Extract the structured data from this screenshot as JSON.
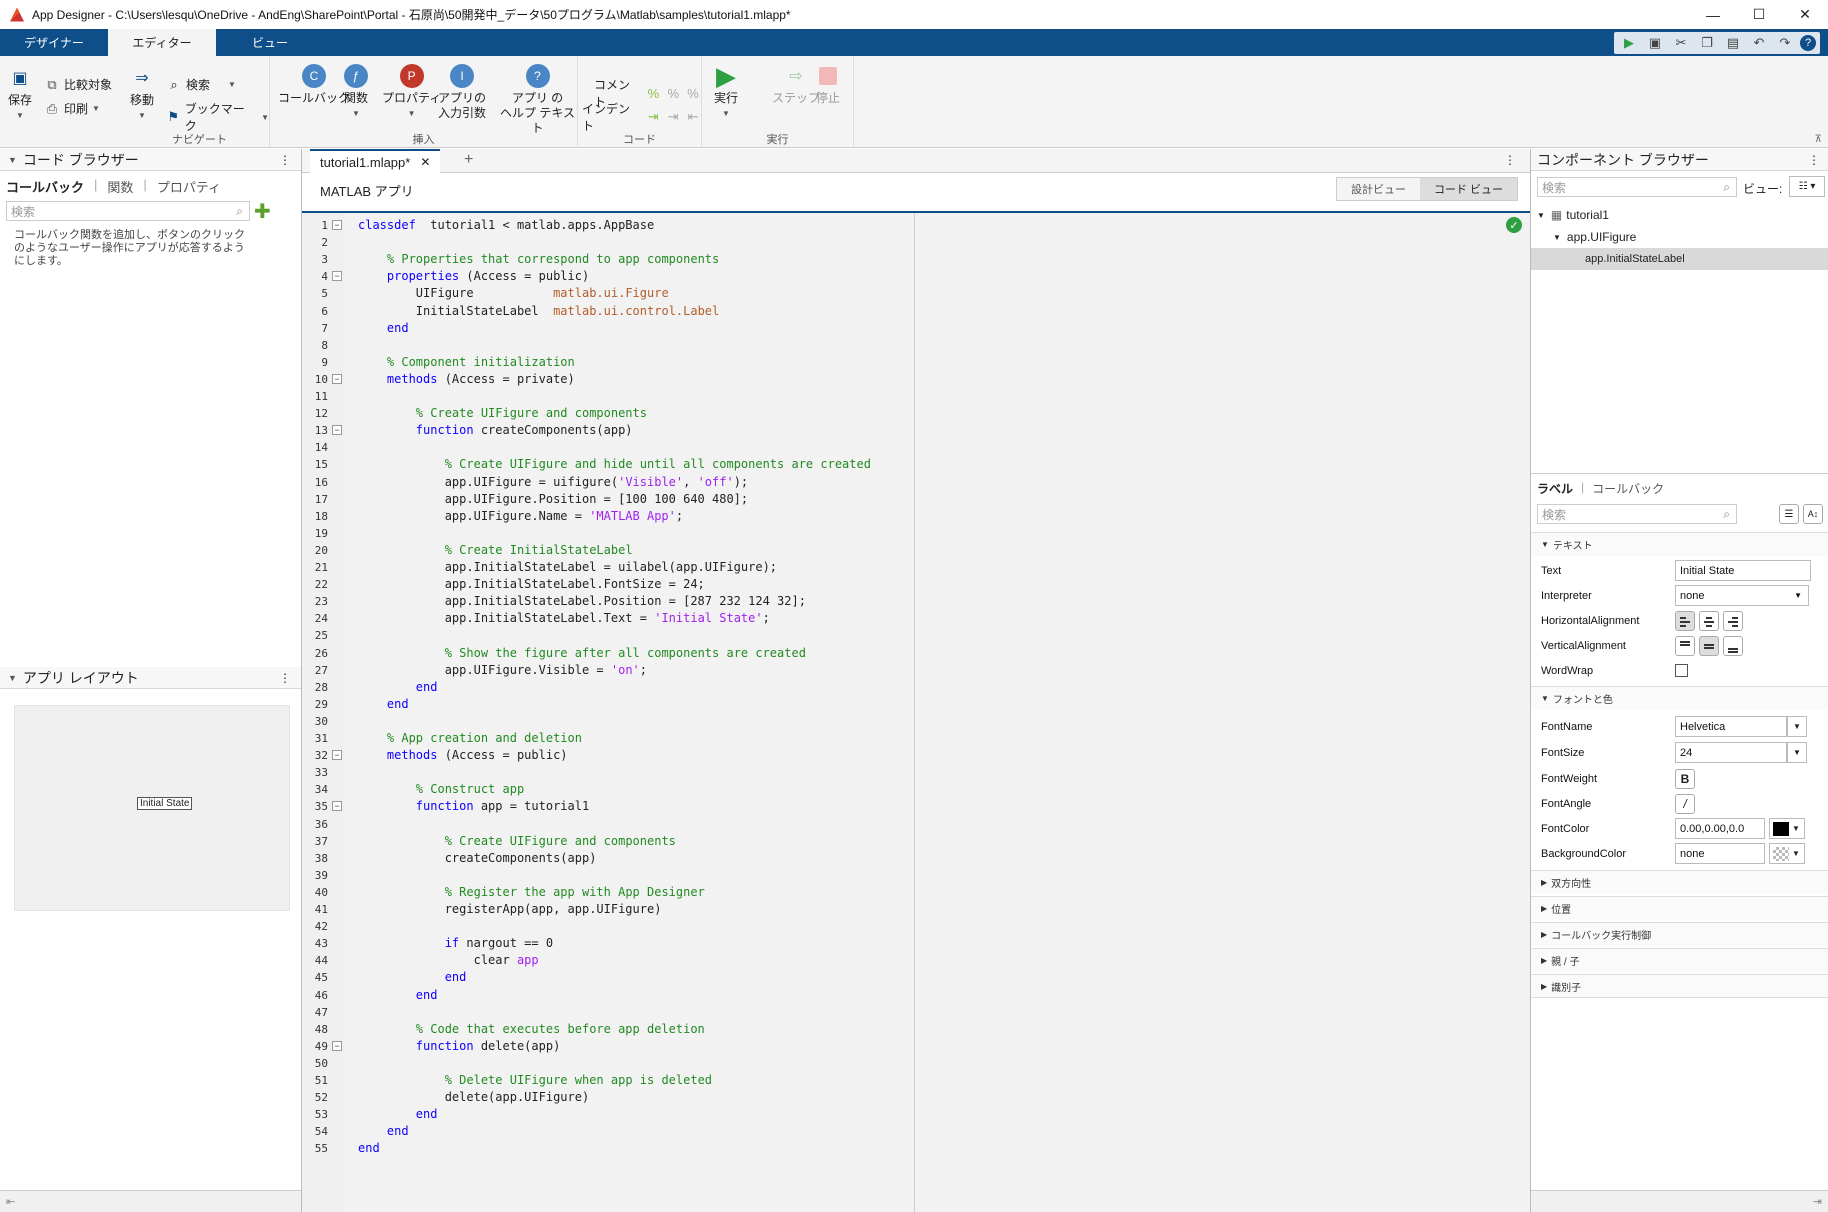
{
  "window": {
    "title": "App Designer - C:\\Users\\lesqu\\OneDrive - AndEng\\SharePoint\\Portal - 石原尚\\50開発中_データ\\50プログラム\\Matlab\\samples\\tutorial1.mlapp*",
    "minimize": "—",
    "maximize": "☐",
    "close": "✕"
  },
  "tabs": [
    {
      "label": "デザイナー"
    },
    {
      "label": "エディター"
    },
    {
      "label": "ビュー"
    }
  ],
  "ribbon": {
    "save": "保存",
    "compare": "比較対象",
    "print": "印刷",
    "move": "移動",
    "search": "検索",
    "bookmark": "ブックマーク",
    "navigate_group": "ナビゲート",
    "callback": "コールバック",
    "function": "関数",
    "property": "プロパティ",
    "app_input_1": "アプリの",
    "app_input_2": "入力引数",
    "app_help_1": "アプリ の",
    "app_help_2": "ヘルプ テキスト",
    "insert_group": "挿入",
    "comment": "コメント",
    "indent": "インデント",
    "code_group": "コード",
    "run": "実行",
    "step": "ステップ",
    "stop": "停止",
    "run_group": "実行"
  },
  "code_browser": {
    "title": "コード ブラウザー",
    "tab_callbacks": "コールバック",
    "tab_functions": "関数",
    "tab_properties": "プロパティ",
    "search_placeholder": "検索",
    "hint": "コールバック関数を追加し、ボタンのクリックのようなユーザー操作にアプリが応答するようにします。"
  },
  "app_layout": {
    "title": "アプリ レイアウト",
    "label": "Initial State"
  },
  "editor": {
    "doc_tab": "tutorial1.mlapp*",
    "header": "MATLAB アプリ",
    "design_view": "設計ビュー",
    "code_view": "コード ビュー"
  },
  "code_lines": [
    {
      "n": "1",
      "fold": true,
      "t": [
        [
          "kw",
          "classdef"
        ],
        [
          "",
          "  tutorial1 < matlab.apps.AppBase"
        ]
      ]
    },
    {
      "n": "2",
      "t": []
    },
    {
      "n": "3",
      "t": [
        [
          "",
          "    "
        ],
        [
          "cm",
          "% Properties that correspond to app components"
        ]
      ]
    },
    {
      "n": "4",
      "fold": true,
      "t": [
        [
          "",
          "    "
        ],
        [
          "kw",
          "properties"
        ],
        [
          "",
          " (Access = public)"
        ]
      ]
    },
    {
      "n": "5",
      "t": [
        [
          "",
          "        UIFigure           "
        ],
        [
          "ty",
          "matlab.ui.Figure"
        ]
      ]
    },
    {
      "n": "6",
      "t": [
        [
          "",
          "        InitialStateLabel  "
        ],
        [
          "ty",
          "matlab.ui.control.Label"
        ]
      ]
    },
    {
      "n": "7",
      "t": [
        [
          "",
          "    "
        ],
        [
          "kw",
          "end"
        ]
      ]
    },
    {
      "n": "8",
      "t": []
    },
    {
      "n": "9",
      "t": [
        [
          "",
          "    "
        ],
        [
          "cm",
          "% Component initialization"
        ]
      ]
    },
    {
      "n": "10",
      "fold": true,
      "t": [
        [
          "",
          "    "
        ],
        [
          "kw",
          "methods"
        ],
        [
          "",
          " (Access = private)"
        ]
      ]
    },
    {
      "n": "11",
      "t": []
    },
    {
      "n": "12",
      "t": [
        [
          "",
          "        "
        ],
        [
          "cm",
          "% Create UIFigure and components"
        ]
      ]
    },
    {
      "n": "13",
      "fold": true,
      "t": [
        [
          "",
          "        "
        ],
        [
          "kw",
          "function"
        ],
        [
          "",
          " createComponents(app)"
        ]
      ]
    },
    {
      "n": "14",
      "t": []
    },
    {
      "n": "15",
      "t": [
        [
          "",
          "            "
        ],
        [
          "cm",
          "% Create UIFigure and hide until all components are created"
        ]
      ]
    },
    {
      "n": "16",
      "t": [
        [
          "",
          "            app.UIFigure = uifigure("
        ],
        [
          "st",
          "'Visible'"
        ],
        [
          "",
          ", "
        ],
        [
          "st",
          "'off'"
        ],
        [
          "",
          ");"
        ]
      ]
    },
    {
      "n": "17",
      "t": [
        [
          "",
          "            app.UIFigure.Position = [100 100 640 480];"
        ]
      ]
    },
    {
      "n": "18",
      "t": [
        [
          "",
          "            app.UIFigure.Name = "
        ],
        [
          "st",
          "'MATLAB App'"
        ],
        [
          "",
          ";"
        ]
      ]
    },
    {
      "n": "19",
      "t": []
    },
    {
      "n": "20",
      "t": [
        [
          "",
          "            "
        ],
        [
          "cm",
          "% Create InitialStateLabel"
        ]
      ]
    },
    {
      "n": "21",
      "t": [
        [
          "",
          "            app.InitialStateLabel = uilabel(app.UIFigure);"
        ]
      ]
    },
    {
      "n": "22",
      "t": [
        [
          "",
          "            app.InitialStateLabel.FontSize = 24;"
        ]
      ]
    },
    {
      "n": "23",
      "t": [
        [
          "",
          "            app.InitialStateLabel.Position = [287 232 124 32];"
        ]
      ]
    },
    {
      "n": "24",
      "t": [
        [
          "",
          "            app.InitialStateLabel.Text = "
        ],
        [
          "st",
          "'Initial State'"
        ],
        [
          "",
          ";"
        ]
      ]
    },
    {
      "n": "25",
      "t": []
    },
    {
      "n": "26",
      "t": [
        [
          "",
          "            "
        ],
        [
          "cm",
          "% Show the figure after all components are created"
        ]
      ]
    },
    {
      "n": "27",
      "t": [
        [
          "",
          "            app.UIFigure.Visible = "
        ],
        [
          "st",
          "'on'"
        ],
        [
          "",
          ";"
        ]
      ]
    },
    {
      "n": "28",
      "t": [
        [
          "",
          "        "
        ],
        [
          "kw",
          "end"
        ]
      ]
    },
    {
      "n": "29",
      "t": [
        [
          "",
          "    "
        ],
        [
          "kw",
          "end"
        ]
      ]
    },
    {
      "n": "30",
      "t": []
    },
    {
      "n": "31",
      "t": [
        [
          "",
          "    "
        ],
        [
          "cm",
          "% App creation and deletion"
        ]
      ]
    },
    {
      "n": "32",
      "fold": true,
      "t": [
        [
          "",
          "    "
        ],
        [
          "kw",
          "methods"
        ],
        [
          "",
          " (Access = public)"
        ]
      ]
    },
    {
      "n": "33",
      "t": []
    },
    {
      "n": "34",
      "t": [
        [
          "",
          "        "
        ],
        [
          "cm",
          "% Construct app"
        ]
      ]
    },
    {
      "n": "35",
      "fold": true,
      "t": [
        [
          "",
          "        "
        ],
        [
          "kw",
          "function"
        ],
        [
          "",
          " app = tutorial1"
        ]
      ]
    },
    {
      "n": "36",
      "t": []
    },
    {
      "n": "37",
      "t": [
        [
          "",
          "            "
        ],
        [
          "cm",
          "% Create UIFigure and components"
        ]
      ]
    },
    {
      "n": "38",
      "t": [
        [
          "",
          "            createComponents(app)"
        ]
      ]
    },
    {
      "n": "39",
      "t": []
    },
    {
      "n": "40",
      "t": [
        [
          "",
          "            "
        ],
        [
          "cm",
          "% Register the app with App Designer"
        ]
      ]
    },
    {
      "n": "41",
      "t": [
        [
          "",
          "            registerApp(app, app.UIFigure)"
        ]
      ]
    },
    {
      "n": "42",
      "t": []
    },
    {
      "n": "43",
      "t": [
        [
          "",
          "            "
        ],
        [
          "kw",
          "if"
        ],
        [
          "",
          " nargout == 0"
        ]
      ]
    },
    {
      "n": "44",
      "t": [
        [
          "",
          "                clear "
        ],
        [
          "st",
          "app"
        ]
      ]
    },
    {
      "n": "45",
      "t": [
        [
          "",
          "            "
        ],
        [
          "kw",
          "end"
        ]
      ]
    },
    {
      "n": "46",
      "t": [
        [
          "",
          "        "
        ],
        [
          "kw",
          "end"
        ]
      ]
    },
    {
      "n": "47",
      "t": []
    },
    {
      "n": "48",
      "t": [
        [
          "",
          "        "
        ],
        [
          "cm",
          "% Code that executes before app deletion"
        ]
      ]
    },
    {
      "n": "49",
      "fold": true,
      "t": [
        [
          "",
          "        "
        ],
        [
          "kw",
          "function"
        ],
        [
          "",
          " delete(app)"
        ]
      ]
    },
    {
      "n": "50",
      "t": []
    },
    {
      "n": "51",
      "t": [
        [
          "",
          "            "
        ],
        [
          "cm",
          "% Delete UIFigure when app is deleted"
        ]
      ]
    },
    {
      "n": "52",
      "t": [
        [
          "",
          "            delete(app.UIFigure)"
        ]
      ]
    },
    {
      "n": "53",
      "t": [
        [
          "",
          "        "
        ],
        [
          "kw",
          "end"
        ]
      ]
    },
    {
      "n": "54",
      "t": [
        [
          "",
          "    "
        ],
        [
          "kw",
          "end"
        ]
      ]
    },
    {
      "n": "55",
      "t": [
        [
          "kw",
          "end"
        ]
      ]
    }
  ],
  "component_browser": {
    "title": "コンポーネント ブラウザー",
    "search_placeholder": "検索",
    "view_label": "ビュー:",
    "tree": [
      "tutorial1",
      "app.UIFigure",
      "app.InitialStateLabel"
    ]
  },
  "inspector": {
    "tab_label": "ラベル",
    "tab_callback": "コールバック",
    "search_placeholder": "検索",
    "section_text": "テキスト",
    "text_label": "Text",
    "text_value": "Initial State",
    "interpreter_label": "Interpreter",
    "interpreter_value": "none",
    "halign_label": "HorizontalAlignment",
    "valign_label": "VerticalAlignment",
    "wordwrap_label": "WordWrap",
    "section_font": "フォントと色",
    "fontname_label": "FontName",
    "fontname_value": "Helvetica",
    "fontsize_label": "FontSize",
    "fontsize_value": "24",
    "fontweight_label": "FontWeight",
    "fontweight_glyph": "B",
    "fontangle_label": "FontAngle",
    "fontangle_glyph": "/",
    "fontcolor_label": "FontColor",
    "fontcolor_value": "0.00,0.00,0.0",
    "bgcolor_label": "BackgroundColor",
    "bgcolor_value": "none",
    "sections_collapsed": [
      "双方向性",
      "位置",
      "コールバック実行制御",
      "親 / 子",
      "識別子"
    ]
  },
  "colors": {
    "accent": "#0e4f8a",
    "run_green": "#2ea043"
  }
}
